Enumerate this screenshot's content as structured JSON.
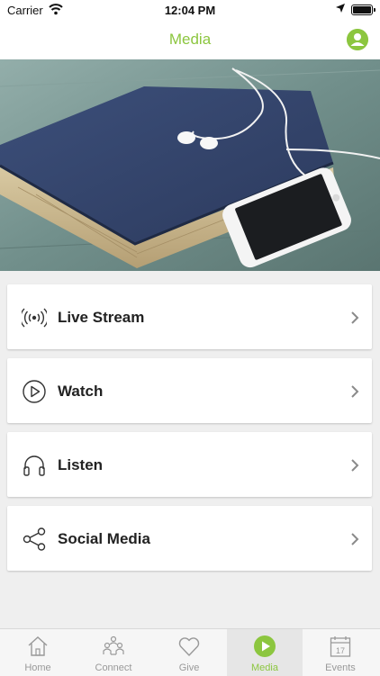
{
  "status_bar": {
    "carrier": "Carrier",
    "time": "12:04 PM"
  },
  "nav": {
    "title": "Media"
  },
  "menu": {
    "items": [
      {
        "label": "Live Stream",
        "icon": "live-stream-icon"
      },
      {
        "label": "Watch",
        "icon": "play-circle-icon"
      },
      {
        "label": "Listen",
        "icon": "headphones-icon"
      },
      {
        "label": "Social Media",
        "icon": "share-icon"
      }
    ]
  },
  "tabs": [
    {
      "label": "Home",
      "icon": "home-icon",
      "active": false
    },
    {
      "label": "Connect",
      "icon": "people-icon",
      "active": false
    },
    {
      "label": "Give",
      "icon": "heart-icon",
      "active": false
    },
    {
      "label": "Media",
      "icon": "play-icon",
      "active": true
    },
    {
      "label": "Events",
      "icon": "calendar-icon",
      "active": false
    }
  ],
  "colors": {
    "accent": "#8cc63f",
    "tab_inactive": "#999999"
  }
}
